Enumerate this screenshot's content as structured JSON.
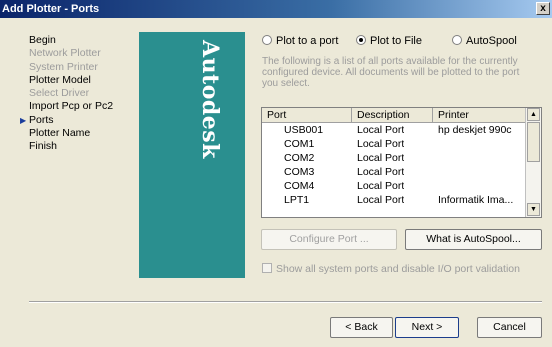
{
  "window": {
    "title": "Add Plotter - Ports",
    "close_glyph": "x"
  },
  "steps": [
    {
      "label": "Begin",
      "state": "enabled"
    },
    {
      "label": "Network Plotter",
      "state": "disabled"
    },
    {
      "label": "System Printer",
      "state": "disabled"
    },
    {
      "label": "Plotter Model",
      "state": "enabled"
    },
    {
      "label": "Select Driver",
      "state": "disabled"
    },
    {
      "label": "Import Pcp or Pc2",
      "state": "enabled"
    },
    {
      "label": "Ports",
      "state": "current"
    },
    {
      "label": "Plotter Name",
      "state": "enabled"
    },
    {
      "label": "Finish",
      "state": "enabled"
    }
  ],
  "brand": {
    "logo_text": "Autodesk",
    "color": "#2a8f8f"
  },
  "radios": {
    "plot_to_port": "Plot to a port",
    "plot_to_file": "Plot to File",
    "autospool": "AutoSpool",
    "selected": "plot_to_file"
  },
  "description": "The following is a list of all ports available for the currently configured device. All documents will be plotted to the port you select.",
  "ports": {
    "headers": {
      "port": "Port",
      "description": "Description",
      "printer": "Printer"
    },
    "rows": [
      {
        "port": "USB001",
        "description": "Local Port",
        "printer": "hp deskjet 990c"
      },
      {
        "port": "COM1",
        "description": "Local Port",
        "printer": ""
      },
      {
        "port": "COM2",
        "description": "Local Port",
        "printer": ""
      },
      {
        "port": "COM3",
        "description": "Local Port",
        "printer": ""
      },
      {
        "port": "COM4",
        "description": "Local Port",
        "printer": ""
      },
      {
        "port": "LPT1",
        "description": "Local Port",
        "printer": "Informatik Ima..."
      }
    ]
  },
  "buttons": {
    "configure_port": "Configure Port ...",
    "what_is_autospool": "What is AutoSpool...",
    "back": "< Back",
    "next": "Next >",
    "cancel": "Cancel"
  },
  "checkbox": {
    "label": "Show all system ports and disable I/O port validation",
    "checked": false
  }
}
